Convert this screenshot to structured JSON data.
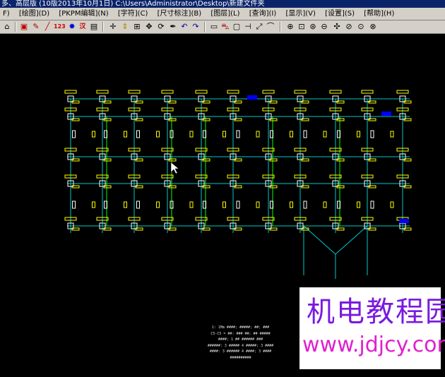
{
  "titlebar": {
    "text": "多、高层版 (10版2013年10月1日)   C:\\Users\\Administrator\\Desktop\\新建文件夹"
  },
  "menu": [
    {
      "label": "F)"
    },
    {
      "label": "[绘图](D)"
    },
    {
      "label": "[PKPM编辑](N)"
    },
    {
      "label": "[字符](C)"
    },
    {
      "label": "[尺寸标注](B)"
    },
    {
      "label": "[图层](L)"
    },
    {
      "label": "[查询](I)"
    },
    {
      "label": "[显示](V)"
    },
    {
      "label": "[设置](S)"
    },
    {
      "label": "[帮助](H)"
    }
  ],
  "toolbar": {
    "icons": [
      "open-icon",
      "print-icon",
      "brush-icon",
      "line-icon",
      "numbers-icon",
      "paint-icon",
      "text-icon",
      "window-icon",
      "crosshair-icon",
      "arrows-icon",
      "grid-icon",
      "move-icon",
      "rotate-icon",
      "pen-icon",
      "undo-icon",
      "redo-icon",
      "copy-icon",
      "car-icon",
      "rect-icon",
      "dim-icon",
      "slash-icon",
      "curve-icon",
      "zoom-in-icon",
      "zoom-window-icon",
      "zoom-all-icon",
      "zoom-out-icon",
      "pan-icon",
      "zoom-prev-icon",
      "zoom-next-icon",
      "zoom-extent-icon"
    ],
    "numbers_label": "123"
  },
  "drawing": {
    "colors": {
      "grid": "#00c8c8",
      "beam": "#00ff00",
      "column": "#ffffff",
      "label": "#ffff00",
      "tag": "#0000ff",
      "bg": "#000000"
    }
  },
  "stats": [
    "1: 1Mm ####; #####; ##; ###",
    "C5-C5 = ##: ### ##; ## #####",
    "####; 1 ## ###### ###",
    "######: 3 ##### 4 #####; 3 ####",
    "####: 3 ###### 4 ####; 3 ####",
    "##########"
  ],
  "watermark": {
    "cn": "机电教程园",
    "url": "www.jdjcy.com"
  }
}
